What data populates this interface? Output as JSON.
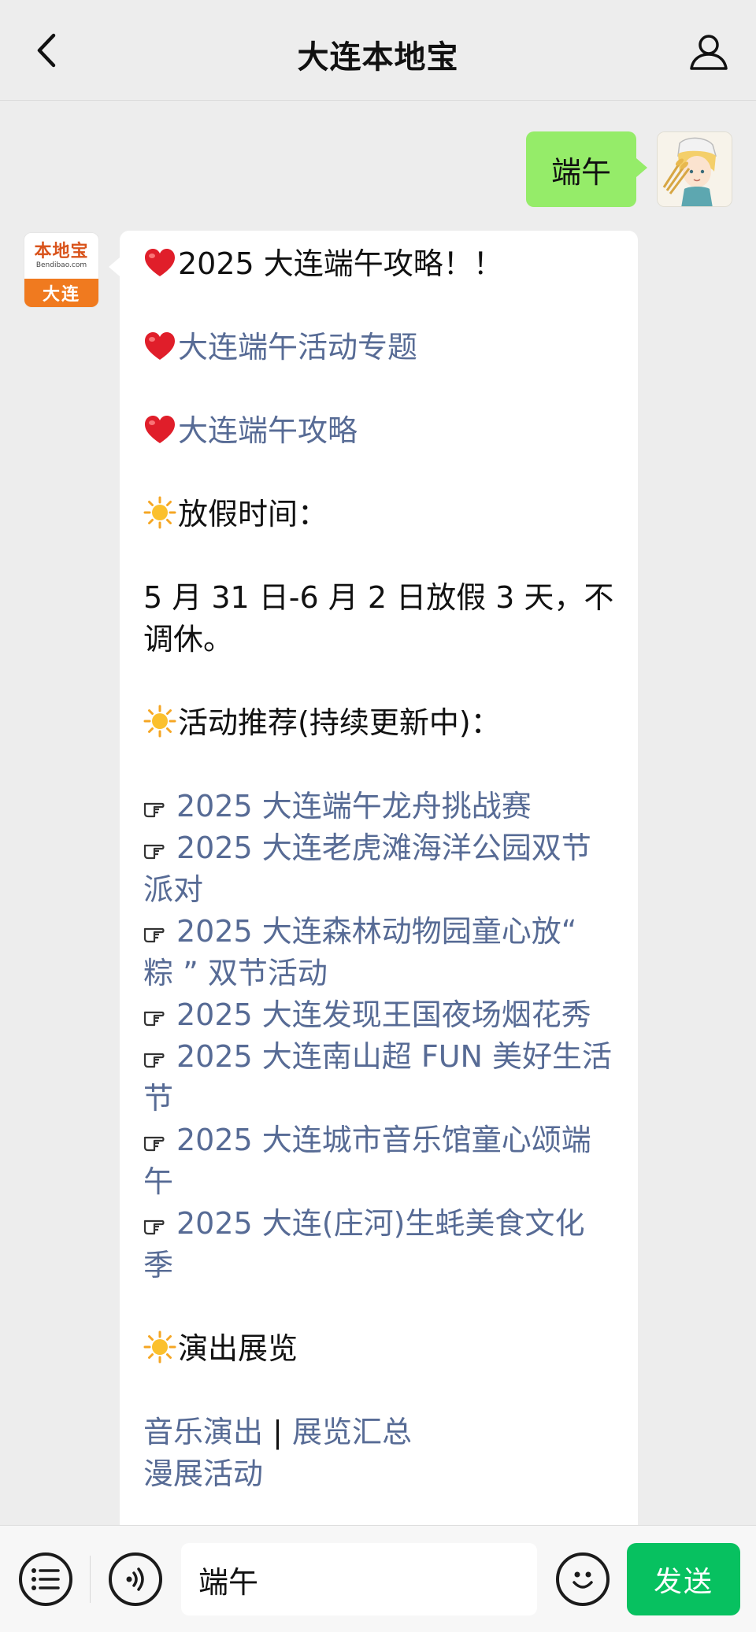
{
  "header": {
    "title": "大连本地宝",
    "back_icon": "chevron-left-icon",
    "user_icon": "user-profile-icon"
  },
  "outgoing": {
    "text": "端午"
  },
  "incoming": {
    "avatar": {
      "logo_cn": "本地宝",
      "logo_url": "Bendibao.com",
      "city": "大连"
    },
    "lines": {
      "l1": "2025 大连端午攻略！！",
      "l2": "大连端午活动专题",
      "l3": "大连端午攻略",
      "l4": "放假时间：",
      "l5a": "5 月 31 日-6 月 2 日放假 3 天，不",
      "l5b": "调休。",
      "l6": "活动推荐(持续更新中)：",
      "act1": "2025 大连端午龙舟挑战赛",
      "act2a": "2025 大连老虎滩海洋公园双节",
      "act2b": "派对",
      "act3a": "2025 大连森林动物园童心放“",
      "act3b": "粽 ” 双节活动",
      "act4": "2025 大连发现王国夜场烟花秀",
      "act5a": "2025 大连南山超 FUN 美好生活",
      "act5b": "节",
      "act6a": "2025 大连城市音乐馆童心颂端",
      "act6b": "午",
      "act7a": "2025 大连(庄河)生蚝美食文化",
      "act7b": "季",
      "l7": "演出展览",
      "music": "音乐演出",
      "sep": "|",
      "exhibit": "展览汇总",
      "comic": "漫展活动"
    }
  },
  "bottom_bar": {
    "menu_icon": "list-menu-icon",
    "voice_icon": "voice-icon",
    "input_value": "端午",
    "emoji_icon": "emoji-icon",
    "send_label": "发送"
  },
  "colors": {
    "background": "#ededed",
    "outgoing_bubble": "#95ec69",
    "link": "#576b95",
    "send_button": "#07c160",
    "brand_orange": "#f07a1f"
  }
}
